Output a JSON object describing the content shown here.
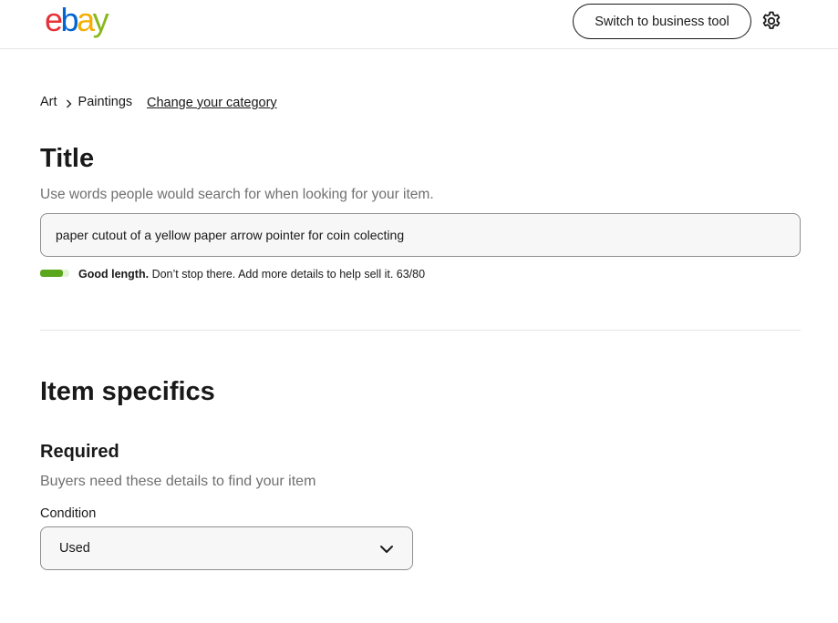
{
  "header": {
    "logo": {
      "e": "e",
      "b": "b",
      "a": "a",
      "y": "y"
    },
    "business_button": "Switch to business tool",
    "settings_icon": "gear-icon"
  },
  "breadcrumb": {
    "items": [
      "Art",
      "Paintings"
    ],
    "separator_icon": "chevron-right-icon",
    "change_link": "Change your category"
  },
  "title_section": {
    "heading": "Title",
    "help": "Use words people would search for when looking for your item.",
    "value": "paper cutout of a yellow paper arrow pointer for coin colecting",
    "meter": {
      "fraction": 0.7875,
      "status": "Good length.",
      "message": "Don’t stop there. Add more details to help sell it.",
      "count": "63/80",
      "color": "#5ba71b"
    }
  },
  "specifics": {
    "heading": "Item specifics",
    "required_heading": "Required",
    "required_help": "Buyers need these details to find your item",
    "condition": {
      "label": "Condition",
      "value": "Used",
      "icon": "chevron-down-icon"
    }
  },
  "colors": {
    "logo_e": "#e53238",
    "logo_b": "#0064d2",
    "logo_a": "#f5af02",
    "logo_y": "#86b817"
  }
}
